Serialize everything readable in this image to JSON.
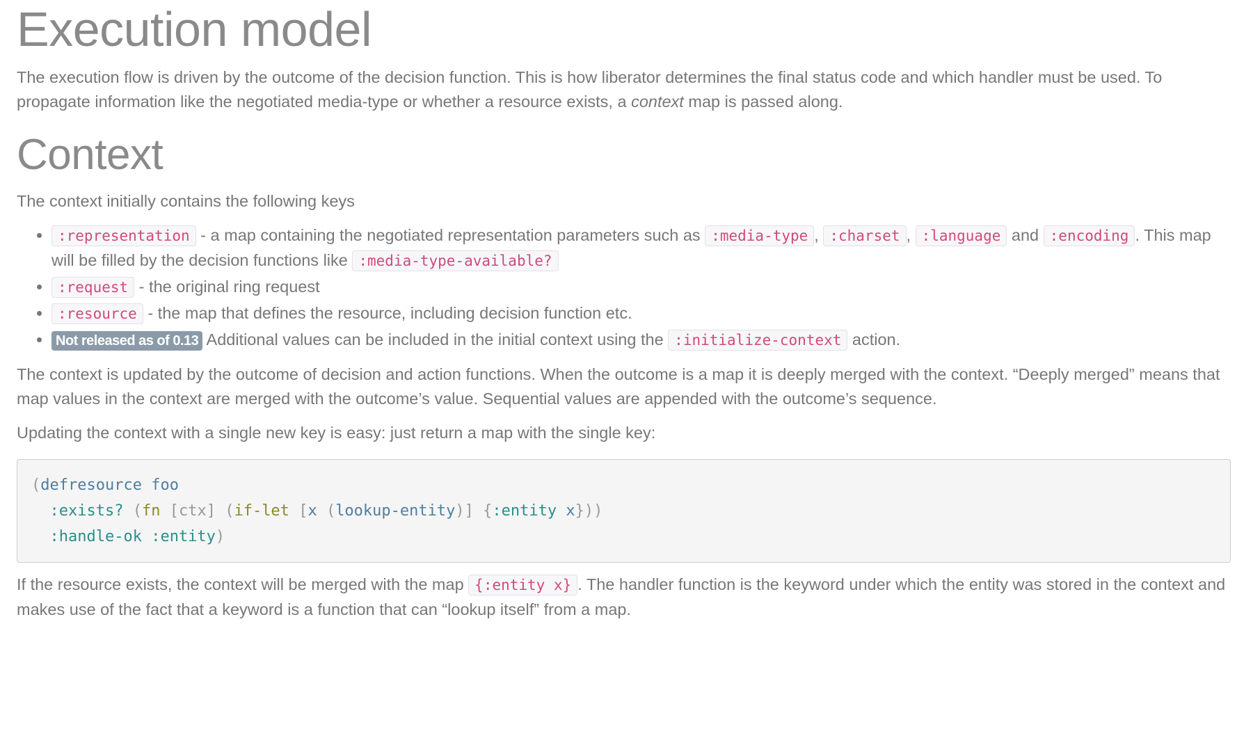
{
  "title": "Execution model",
  "intro": {
    "text1": "The execution flow is driven by the outcome of the decision function. This is how liberator determines the final status code and which handler must be used. To propagate information like the negotiated media-type or whether a resource exists, a ",
    "em": "context",
    "text2": " map is passed along."
  },
  "context_heading": "Context",
  "context_intro": "The context initially contains the following keys",
  "keys": {
    "representation": {
      "code": ":representation",
      "t1": " - a map containing the negotiated representation parameters such as ",
      "c_media": ":media-type",
      "sep1": ", ",
      "c_charset": ":charset",
      "sep2": ", ",
      "c_language": ":language",
      "and": " and ",
      "c_encoding": ":encoding",
      "t2": ". This map will be filled by the decision functions like ",
      "c_available": ":media-type-available?"
    },
    "request": {
      "code": ":request",
      "text": " - the original ring request"
    },
    "resource": {
      "code": ":resource",
      "text": " - the map that defines the resource, including decision function etc."
    },
    "initialize": {
      "badge": "Not released as of 0.13",
      "text": " Additional values can be included in the initial context using the ",
      "code": ":initialize-context",
      "tail": " action."
    }
  },
  "para_update": "The context is updated by the outcome of decision and action functions. When the outcome is a map it is deeply merged with the context. “Deeply merged” means that map values in the context are merged with the outcome’s value. Sequential values are appended with the outcome’s sequence.",
  "para_single": "Updating the context with a single new key is easy: just return a map with the single key:",
  "code_block": {
    "line1": {
      "open": "(",
      "defresource": "defresource",
      "sp": " ",
      "foo": "foo"
    },
    "line2": {
      "indent": "  ",
      "exists": ":exists?",
      "sp1": " ",
      "open1": "(",
      "fn": "fn",
      "sp2": " ",
      "args": "[ctx]",
      "sp3": " ",
      "open2": "(",
      "iflet": "if-let",
      "sp4": " ",
      "bopen": "[",
      "x": "x",
      "sp5": " ",
      "open3": "(",
      "lookup": "lookup-entity",
      "close3": ")",
      "bclose": "]",
      "sp6": " ",
      "mopen": "{",
      "entity": ":entity",
      "sp7": " ",
      "x2": "x",
      "mclose": "}",
      "close2": "))"
    },
    "line3": {
      "indent": "  ",
      "handleok": ":handle-ok",
      "sp": " ",
      "entity": ":entity",
      "close": ")"
    }
  },
  "para_final": {
    "text1": "If the resource exists, the context will be merged with the map ",
    "code": "{:entity x}",
    "text2": ". The handler function is the keyword under which the entity was stored in the context and makes use of the fact that a keyword is a function that can “lookup itself” from a map."
  }
}
